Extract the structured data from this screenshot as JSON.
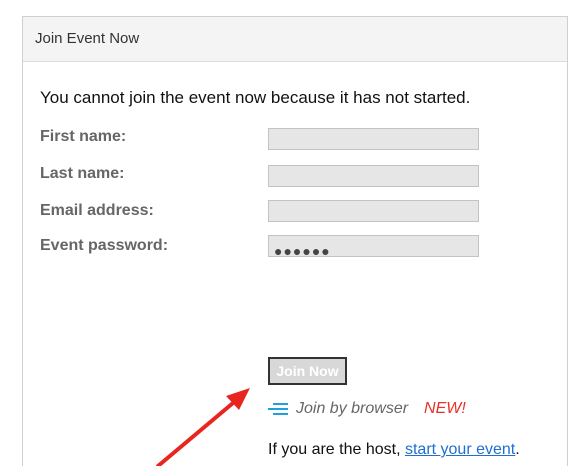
{
  "panel": {
    "title": "Join Event Now"
  },
  "notice": "You cannot join the event now because it has not started.",
  "form": {
    "first_name_label": "First name:",
    "first_name_value": "",
    "last_name_label": "Last name:",
    "last_name_value": "",
    "email_label": "Email address:",
    "email_value": "",
    "password_label": "Event password:",
    "password_mask": "●●●●●●"
  },
  "join_button_label": "Join Now",
  "join_by_browser": {
    "label": "Join by browser",
    "badge": "NEW!",
    "icon": "browser-lines-icon"
  },
  "host_line": {
    "prefix": "If you are the host, ",
    "link": "start your event",
    "suffix": "."
  },
  "annotation": {
    "arrow_color": "#e8261f"
  },
  "colors": {
    "link": "#1f6fd1",
    "new_badge": "#e8312b",
    "icon": "#1fa0dd"
  }
}
